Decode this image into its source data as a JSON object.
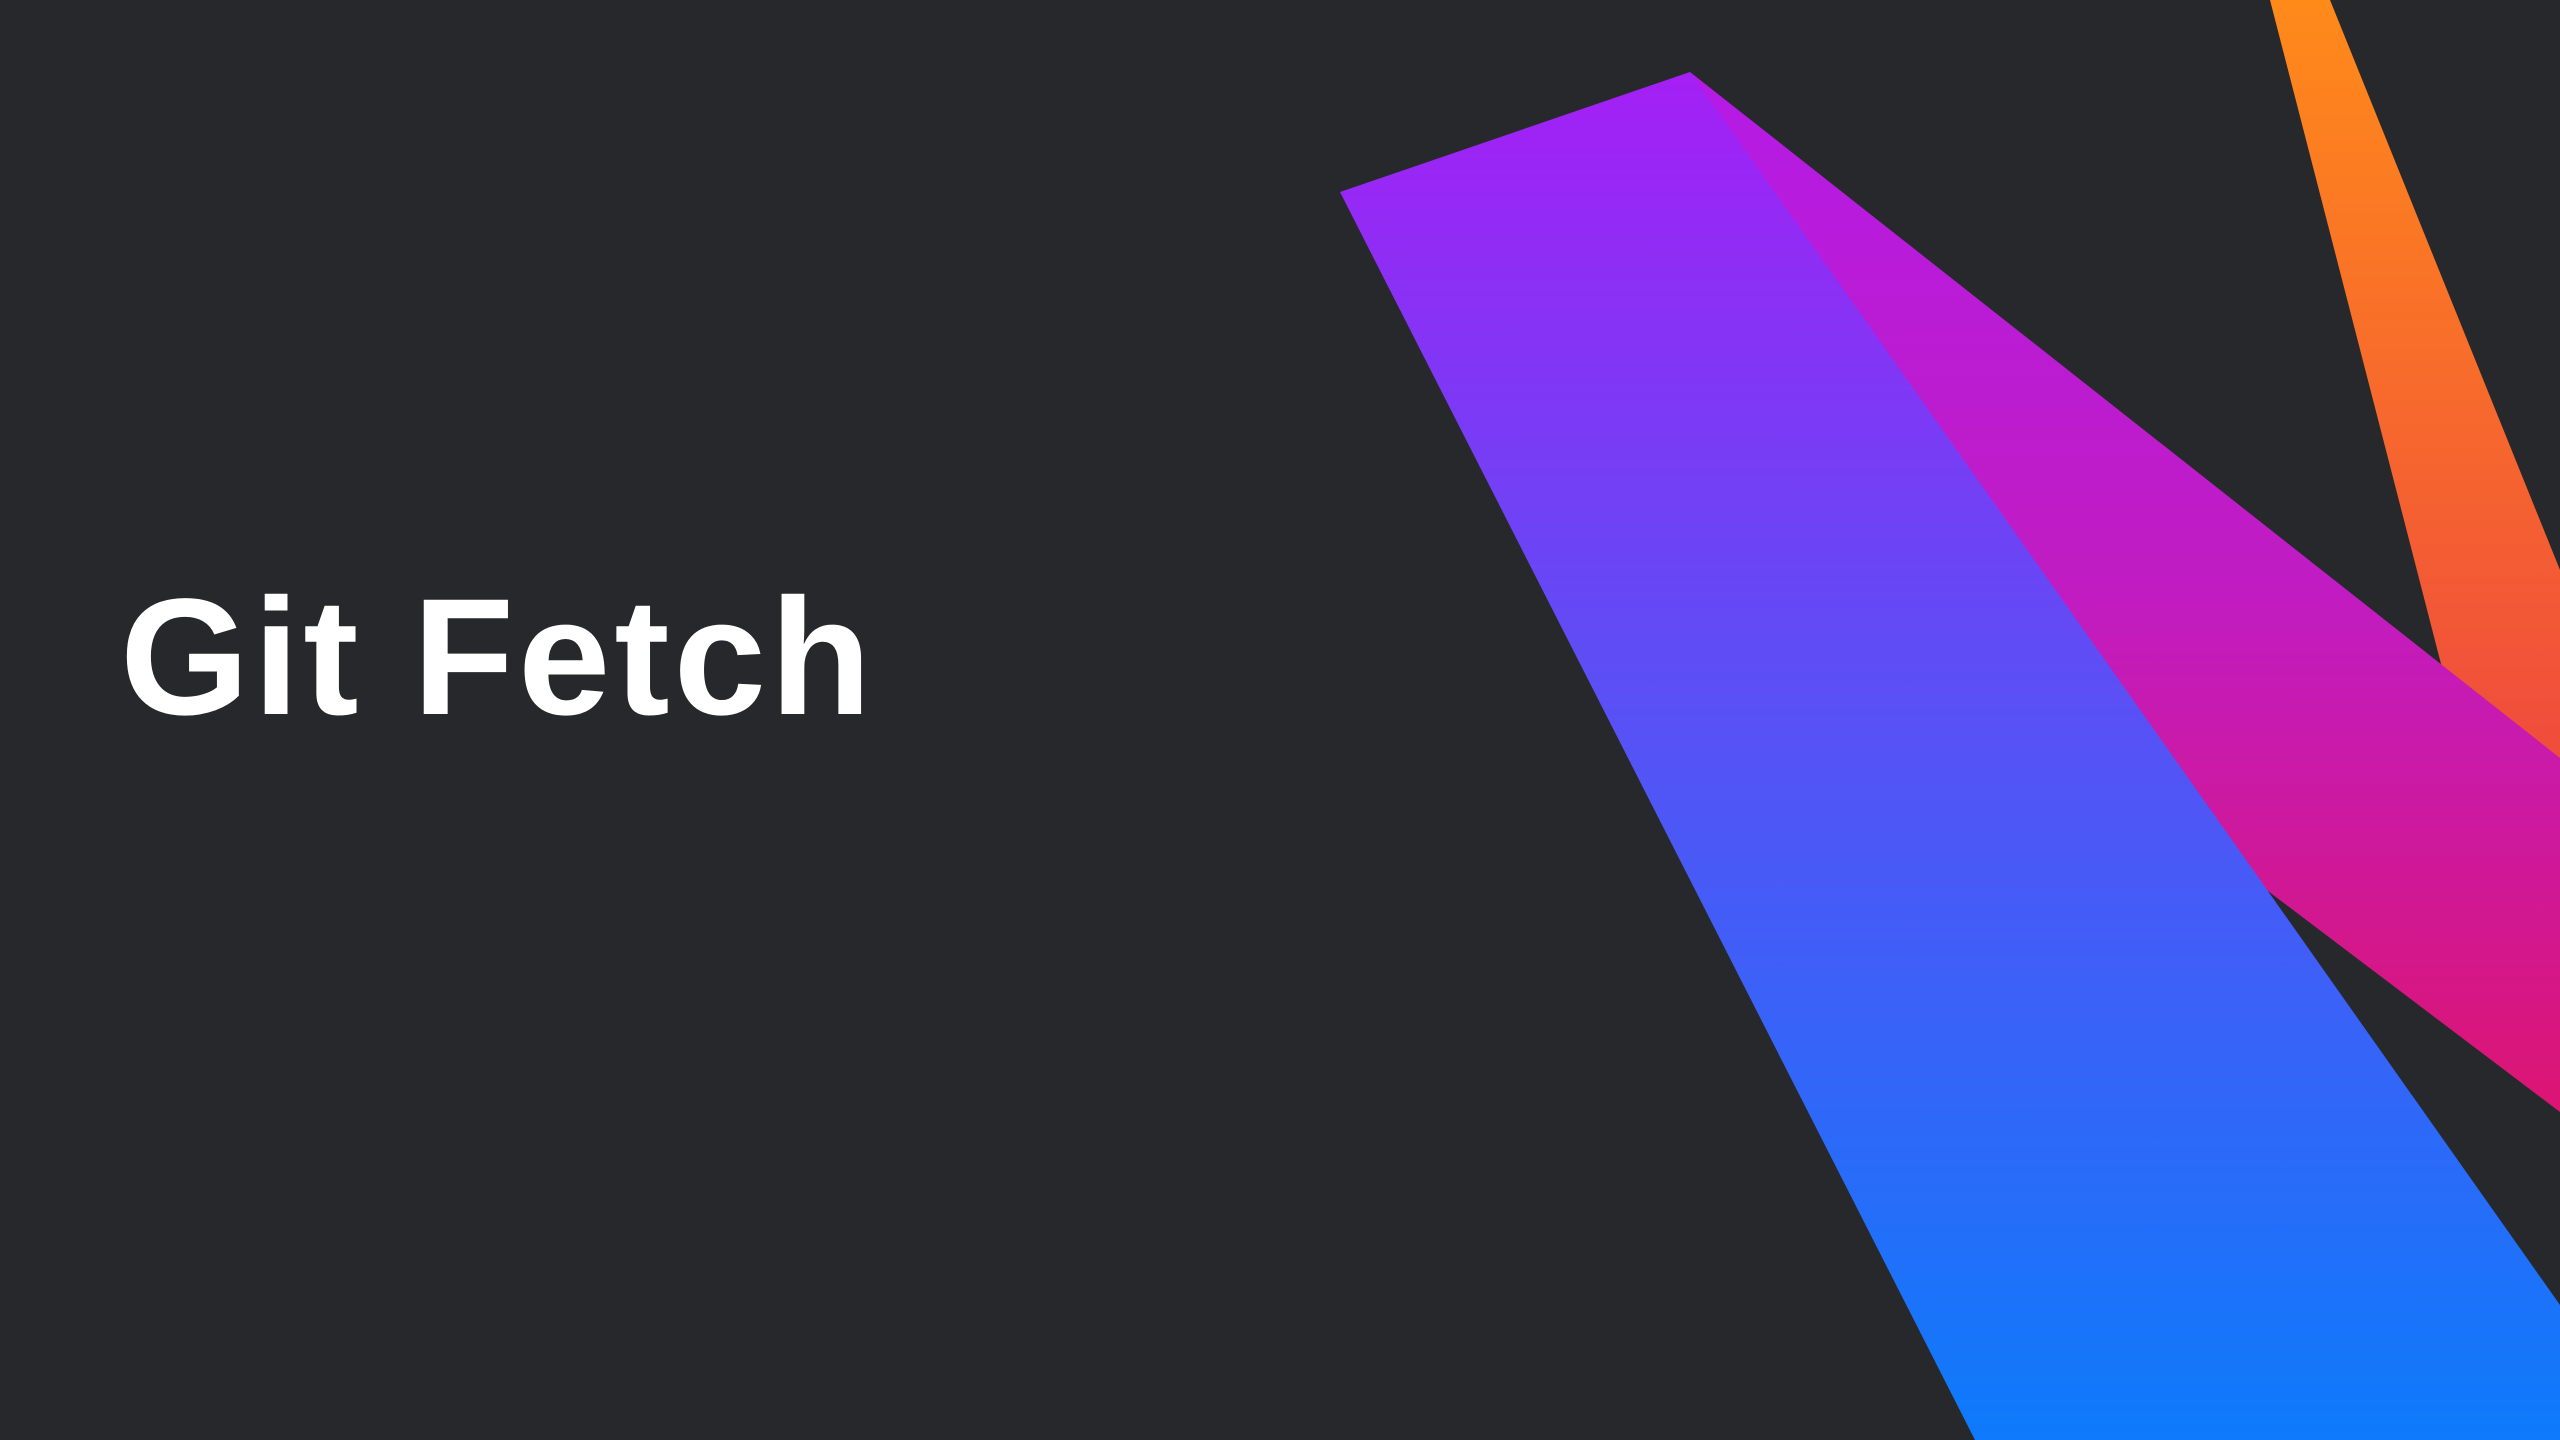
{
  "slide": {
    "title": "Git Fetch"
  },
  "colors": {
    "background": "#27282c",
    "title_text": "#ffffff",
    "orange": "#ff8a1a",
    "red": "#e8304c",
    "magenta": "#c11cc2",
    "pink": "#dc1572",
    "purple": "#a51ff5",
    "blue": "#0d7bfb"
  },
  "graphics": {
    "decoration": "abstract-gradient-stripes"
  }
}
